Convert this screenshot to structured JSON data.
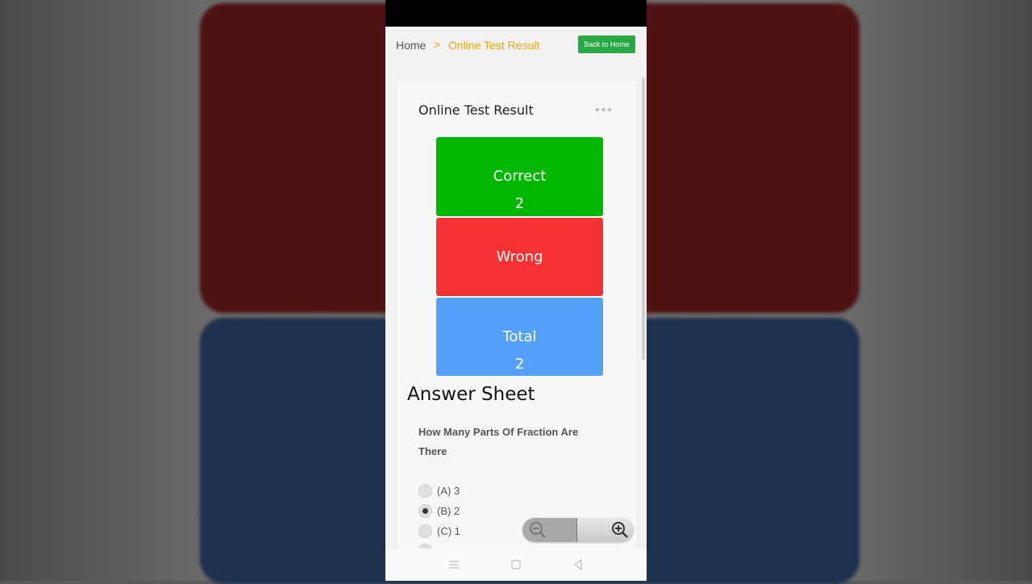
{
  "breadcrumb": {
    "home": "Home",
    "separator": ">",
    "current": "Online Test Result"
  },
  "back_button": "Back to Home",
  "card": {
    "title": "Online Test Result",
    "menu": "•••"
  },
  "stats": {
    "correct_label": "Correct",
    "correct_value": "2",
    "wrong_label": "Wrong",
    "total_label": "Total",
    "total_value": "2"
  },
  "answer_sheet": {
    "heading": "Answer Sheet",
    "question": "How Many Parts Of Fraction Are There",
    "options": [
      {
        "label": "(A) 3",
        "selected": false
      },
      {
        "label": "(B) 2",
        "selected": true
      },
      {
        "label": "(C) 1",
        "selected": false
      }
    ]
  },
  "colors": {
    "correct": "#00b800",
    "wrong": "#f53131",
    "total": "#54a1f9",
    "accent": "#f0a500",
    "button": "#28a745"
  },
  "icons": {
    "zoom_out": "zoom-out-icon",
    "zoom_in": "zoom-in-icon",
    "nav_menu": "menu-icon",
    "nav_home": "square-icon",
    "nav_back": "triangle-back-icon"
  }
}
